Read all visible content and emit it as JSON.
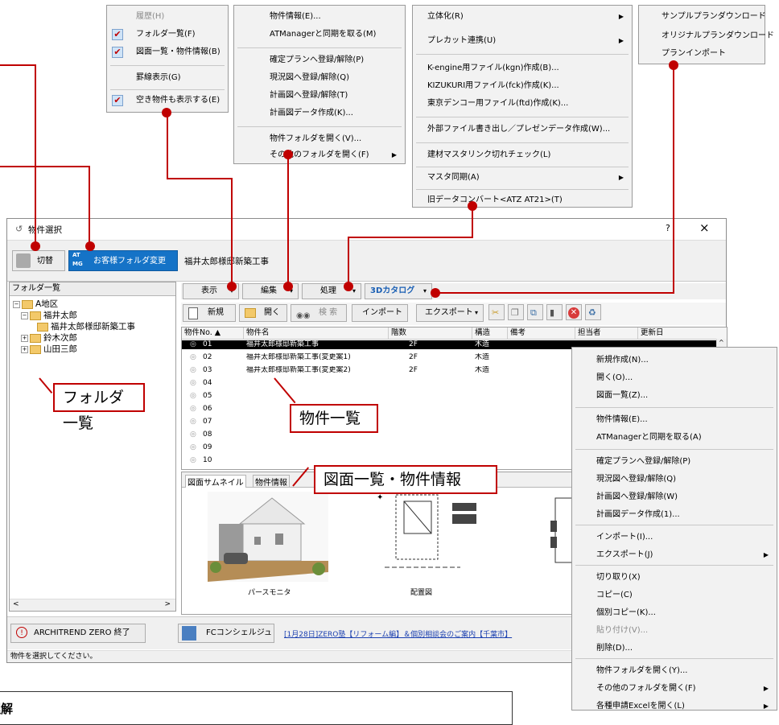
{
  "menus": {
    "view": {
      "items": [
        {
          "label": "履歴(H)",
          "disabled": true,
          "checked": false
        },
        {
          "label": "フォルダ一覧(F)",
          "checked": true
        },
        {
          "label": "図面一覧・物件情報(B)",
          "checked": true
        },
        {
          "label": "罫線表示(G)",
          "checked": false
        },
        {
          "label": "空き物件も表示する(E)",
          "checked": true
        }
      ]
    },
    "edit": {
      "items": [
        "物件情報(E)...",
        "ATManagerと同期を取る(M)",
        "確定プランへ登録/解除(P)",
        "現況図へ登録/解除(Q)",
        "計画図へ登録/解除(T)",
        "計画図データ作成(K)...",
        "物件フォルダを開く(V)...",
        "その他のフォルダを開く(F)"
      ]
    },
    "process": {
      "items": [
        "立体化(R)",
        "プレカット連携(U)",
        "K-engine用ファイル(kgn)作成(B)...",
        "KIZUKURI用ファイル(fck)作成(K)...",
        "東京デンコー用ファイル(ftd)作成(K)...",
        "外部ファイル書き出し／プレゼンデータ作成(W)...",
        "建材マスタリンク切れチェック(L)",
        "マスタ同期(A)",
        "旧データコンバート<ATZ AT21>(T)"
      ]
    },
    "catalog": {
      "items": [
        "サンプルプランダウンロード",
        "オリジナルプランダウンロード",
        "プランインポート"
      ]
    },
    "context": {
      "items": [
        "新規作成(N)...",
        "開く(O)...",
        "図面一覧(Z)...",
        "物件情報(E)...",
        "ATManagerと同期を取る(A)",
        "確定プランへ登録/解除(P)",
        "現況図へ登録/解除(Q)",
        "計画図へ登録/解除(W)",
        "計画図データ作成(1)...",
        "インポート(I)...",
        "エクスポート(J)",
        "切り取り(X)",
        "コピー(C)",
        "個別コピー(K)...",
        "貼り付け(V)...",
        "削除(D)...",
        "物件フォルダを開く(Y)...",
        "その他のフォルダを開く(F)",
        "各種申請Excelを開く(L)"
      ]
    }
  },
  "window": {
    "title": "物件選択",
    "help": "?",
    "close": "×",
    "switch_label": "切替",
    "at_mg": "AT MG",
    "customer_folder_btn": "お客様フォルダ変更",
    "current_property": "福井太郎様邸新築工事",
    "menubar": [
      "表示",
      "編集",
      "処理",
      "3Dカタログ"
    ],
    "toolbar": {
      "new": "新規",
      "open": "開く",
      "search": "検 索",
      "import": "インポート",
      "export": "エクスポート"
    },
    "folder_panel_title": "フォルダ一覧",
    "tree": [
      {
        "label": "A地区",
        "level": 0,
        "toggle": "−"
      },
      {
        "label": "福井太郎",
        "level": 1,
        "toggle": "−"
      },
      {
        "label": "福井太郎様邸新築工事",
        "level": 2,
        "toggle": ""
      },
      {
        "label": "鈴木次郎",
        "level": 1,
        "toggle": "+"
      },
      {
        "label": "山田三郎",
        "level": 1,
        "toggle": "+"
      }
    ],
    "columns": [
      "物件No. ▲",
      "物件名",
      "階数",
      "構造",
      "備考",
      "担当者",
      "更新日"
    ],
    "rows": [
      {
        "no": "01",
        "name": "福井太郎様邸新築工事",
        "floors": "2F",
        "structure": "木造",
        "selected": true
      },
      {
        "no": "02",
        "name": "福井太郎様邸新築工事(変更案1)",
        "floors": "2F",
        "structure": "木造"
      },
      {
        "no": "03",
        "name": "福井太郎様邸新築工事(変更案2)",
        "floors": "2F",
        "structure": "木造"
      },
      {
        "no": "04"
      },
      {
        "no": "05"
      },
      {
        "no": "06"
      },
      {
        "no": "07"
      },
      {
        "no": "08"
      },
      {
        "no": "09"
      },
      {
        "no": "10"
      }
    ],
    "tabs": [
      "図面サムネイル",
      "物件情報"
    ],
    "thumbnails": [
      "パースモニタ",
      "配置図"
    ],
    "exit_btn": "ARCHITREND ZERO 終了",
    "fc_btn": "FCコンシェルジュ",
    "news_link": "[1月28日]ZERO塾【リフォーム編】＆個別相談会のご案内【千葉市】",
    "status": "物件を選択してください。"
  },
  "callouts": {
    "folder": "フォルダ一覧",
    "list": "物件一覧",
    "drawing": "図面一覧・物件情報"
  },
  "bottom_box": "理解"
}
